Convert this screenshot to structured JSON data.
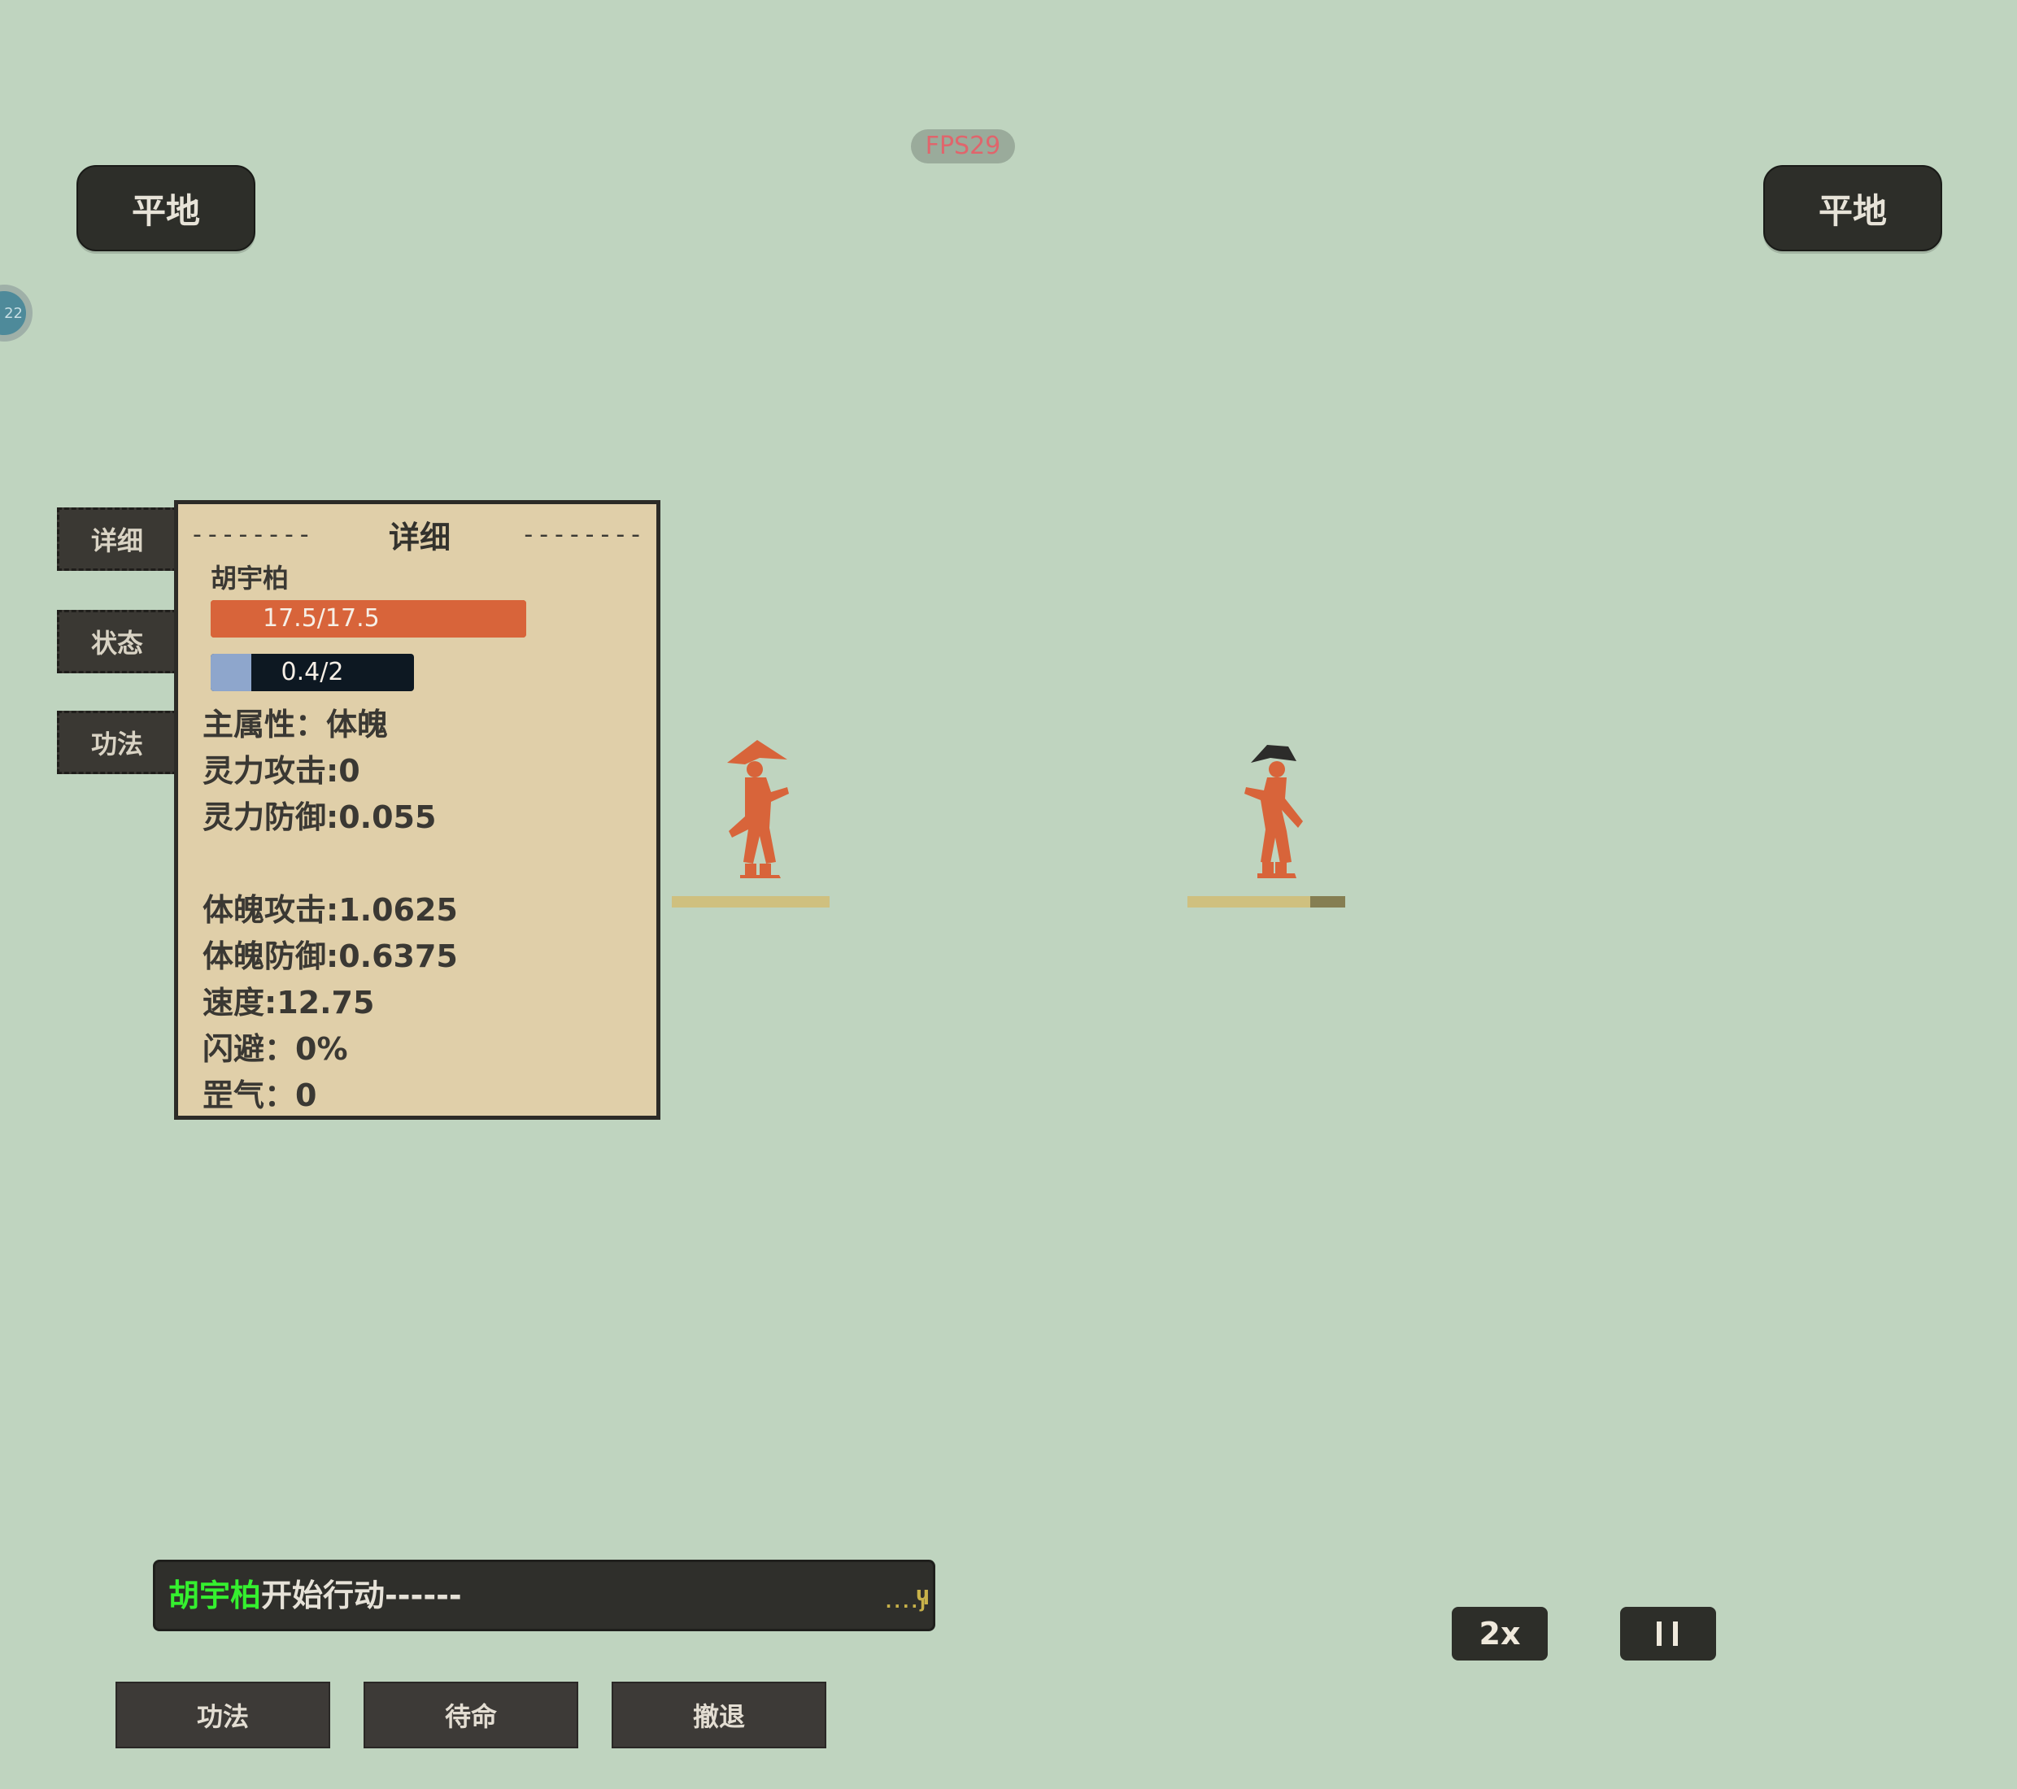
{
  "hud": {
    "fps": "FPS29",
    "round_indicator": "22"
  },
  "terrain": {
    "left": "平地",
    "right": "平地"
  },
  "side_tabs": [
    "详细",
    "状态",
    "功法"
  ],
  "detail_panel": {
    "title": "详细",
    "character_name": "胡宇柏",
    "hp": {
      "text": "17.5/17.5",
      "current": 17.5,
      "max": 17.5
    },
    "mp": {
      "text": "0.4/2",
      "current": 0.4,
      "max": 2
    },
    "stats": [
      "主属性：体魄",
      "灵力攻击:0",
      "灵力防御:0.055",
      "",
      "体魄攻击:1.0625",
      "体魄防御:0.6375",
      "速度:12.75",
      "闪避：0%",
      "罡气：0"
    ]
  },
  "units": {
    "player": {
      "icon": "player-warrior-icon",
      "color": "#d8643a",
      "hat_color": "#d8643a",
      "bar_fill": 1.0
    },
    "enemy": {
      "icon": "enemy-warrior-icon",
      "color": "#d8643a",
      "hat_color": "#2c2c2a",
      "bar_fill": 0.78
    }
  },
  "combat_log": {
    "actor": "胡宇柏",
    "message": "开始行动------"
  },
  "action_buttons": [
    "功法",
    "待命",
    "撤退"
  ],
  "controls": {
    "speed": "2x",
    "pause": "II"
  },
  "colors": {
    "background": "#bfd4bf",
    "hp": "#d8643a",
    "mp": "#8ea6cc",
    "log_actor": "#35f02f"
  }
}
